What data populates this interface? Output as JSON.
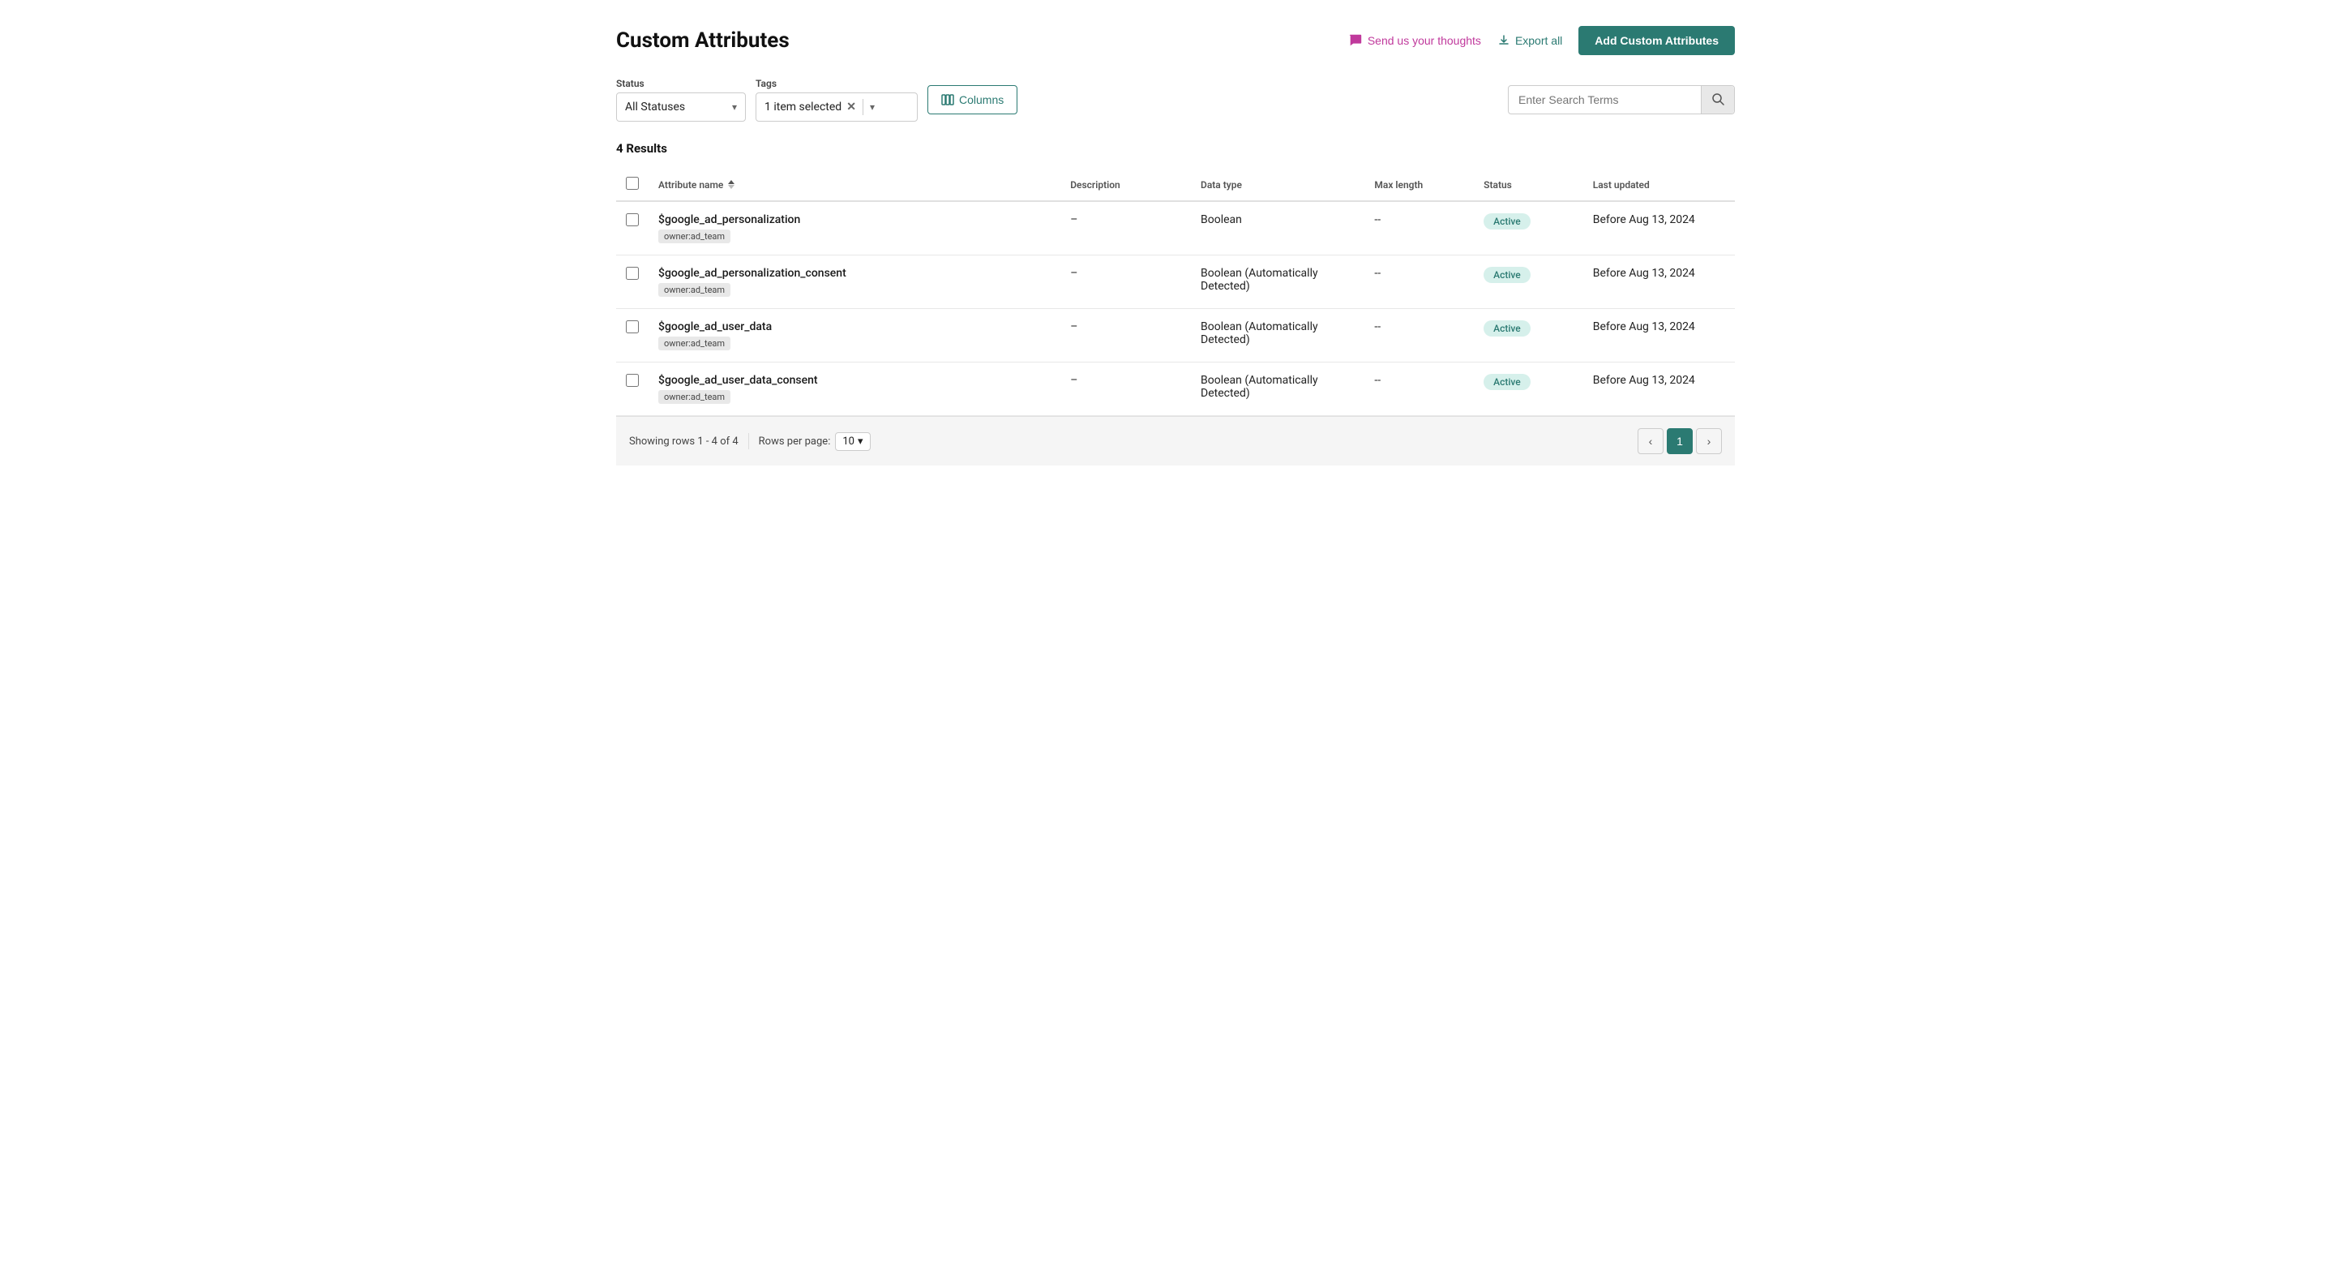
{
  "header": {
    "title": "Custom Attributes",
    "send_thoughts_label": "Send us your thoughts",
    "export_label": "Export all",
    "add_btn_label": "Add Custom Attributes"
  },
  "filters": {
    "status_label": "Status",
    "status_value": "All Statuses",
    "tags_label": "Tags",
    "tags_value": "1 item selected",
    "columns_label": "Columns",
    "search_placeholder": "Enter Search Terms"
  },
  "results": {
    "count_label": "4 Results"
  },
  "table": {
    "columns": [
      {
        "id": "name",
        "label": "Attribute name"
      },
      {
        "id": "description",
        "label": "Description"
      },
      {
        "id": "datatype",
        "label": "Data type"
      },
      {
        "id": "maxlength",
        "label": "Max length"
      },
      {
        "id": "status",
        "label": "Status"
      },
      {
        "id": "lastupdated",
        "label": "Last updated"
      }
    ],
    "rows": [
      {
        "name": "$google_ad_personalization",
        "tag": "owner:ad_team",
        "description": "–",
        "datatype": "Boolean",
        "datatype_note": "",
        "maxlength": "--",
        "status": "Active",
        "lastupdated": "Before Aug 13, 2024"
      },
      {
        "name": "$google_ad_personalization_consent",
        "tag": "owner:ad_team",
        "description": "–",
        "datatype": "Boolean",
        "datatype_note": "(Automatically Detected)",
        "maxlength": "--",
        "status": "Active",
        "lastupdated": "Before Aug 13, 2024"
      },
      {
        "name": "$google_ad_user_data",
        "tag": "owner:ad_team",
        "description": "–",
        "datatype": "Boolean",
        "datatype_note": "(Automatically Detected)",
        "maxlength": "--",
        "status": "Active",
        "lastupdated": "Before Aug 13, 2024"
      },
      {
        "name": "$google_ad_user_data_consent",
        "tag": "owner:ad_team",
        "description": "–",
        "datatype": "Boolean",
        "datatype_note": "(Automatically Detected)",
        "maxlength": "--",
        "status": "Active",
        "lastupdated": "Before Aug 13, 2024"
      }
    ]
  },
  "pagination": {
    "showing": "Showing rows 1 - 4 of 4",
    "rows_per_page_label": "Rows per page:",
    "rows_per_page_value": "10",
    "current_page": "1",
    "prev_label": "‹",
    "next_label": "›"
  },
  "colors": {
    "teal": "#2b7a72",
    "pink": "#c0399c",
    "active_bg": "#d6f0eb",
    "active_text": "#2b7a72"
  }
}
